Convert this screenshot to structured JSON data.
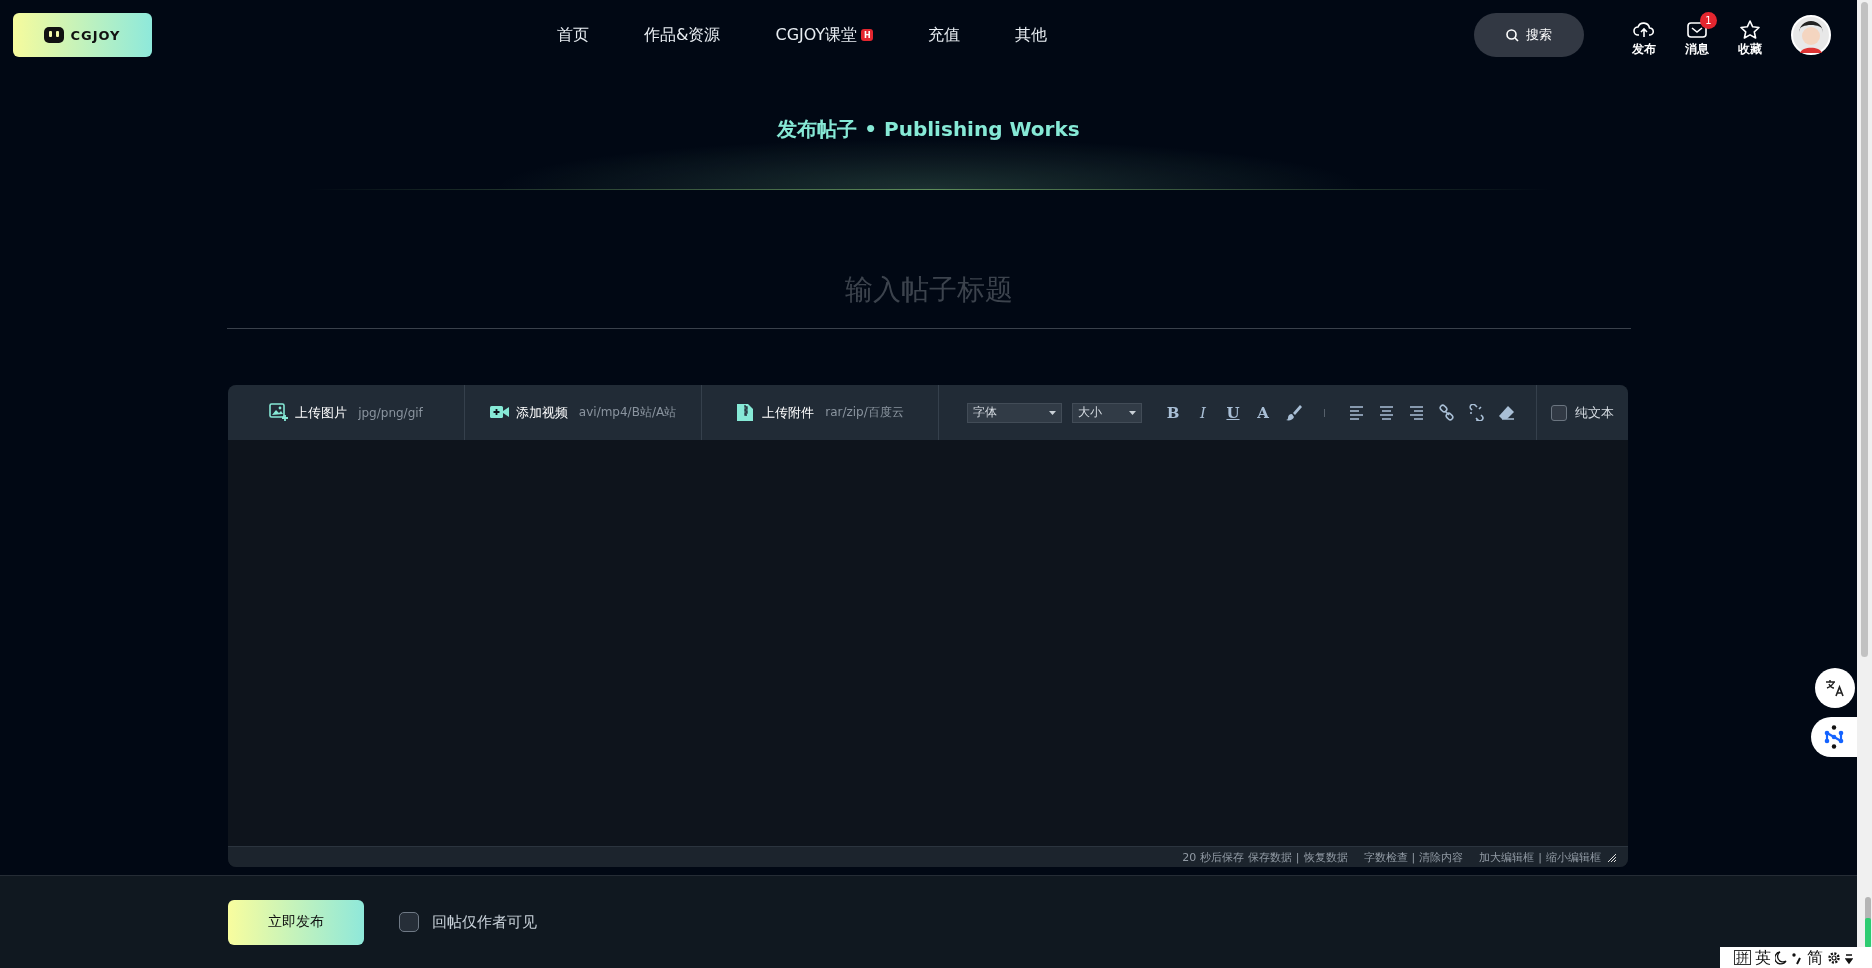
{
  "header": {
    "logo": "CGJOY",
    "nav": [
      {
        "label": "首页"
      },
      {
        "label": "作品&资源"
      },
      {
        "label": "CGJOY课堂",
        "badge": "H"
      },
      {
        "label": "充值"
      },
      {
        "label": "其他"
      }
    ],
    "search": {
      "label": "搜索"
    },
    "actions": [
      {
        "kind": "upload",
        "label": "发布"
      },
      {
        "kind": "message",
        "label": "消息",
        "badge": "1"
      },
      {
        "kind": "star",
        "label": "收藏"
      }
    ]
  },
  "page_title": "发布帖子 • Publishing Works",
  "title_field": {
    "placeholder": "输入帖子标题"
  },
  "editor": {
    "uploads": [
      {
        "kind": "image",
        "label": "上传图片",
        "hint": "jpg/png/gif"
      },
      {
        "kind": "video",
        "label": "添加视频",
        "hint": "avi/mp4/B站/A站"
      },
      {
        "kind": "file",
        "label": "上传附件",
        "hint": "rar/zip/百度云"
      }
    ],
    "font_select": "字体",
    "size_select": "大小",
    "format_buttons": [
      {
        "kind": "bold",
        "label": "B"
      },
      {
        "kind": "italic",
        "label": "I"
      },
      {
        "kind": "underline",
        "label": "U"
      },
      {
        "kind": "color",
        "label": "A"
      },
      {
        "kind": "brush"
      },
      {
        "kind": "sep"
      },
      {
        "kind": "align-left"
      },
      {
        "kind": "align-center"
      },
      {
        "kind": "align-right"
      },
      {
        "kind": "link"
      },
      {
        "kind": "unlink"
      },
      {
        "kind": "eraser"
      }
    ],
    "plain_text": {
      "label": "纯文本",
      "checked": false
    },
    "status_groups": [
      [
        "20 秒后保存",
        "保存数据",
        "|",
        "恢复数据"
      ],
      [
        "字数检查",
        "|",
        "清除内容"
      ],
      [
        "加大编辑框",
        "|",
        "缩小编辑框"
      ]
    ]
  },
  "footer": {
    "submit": "立即发布",
    "author_only": {
      "label": "回帖仅作者可见",
      "checked": false
    }
  },
  "ime": [
    "拼",
    "英",
    "简"
  ]
}
